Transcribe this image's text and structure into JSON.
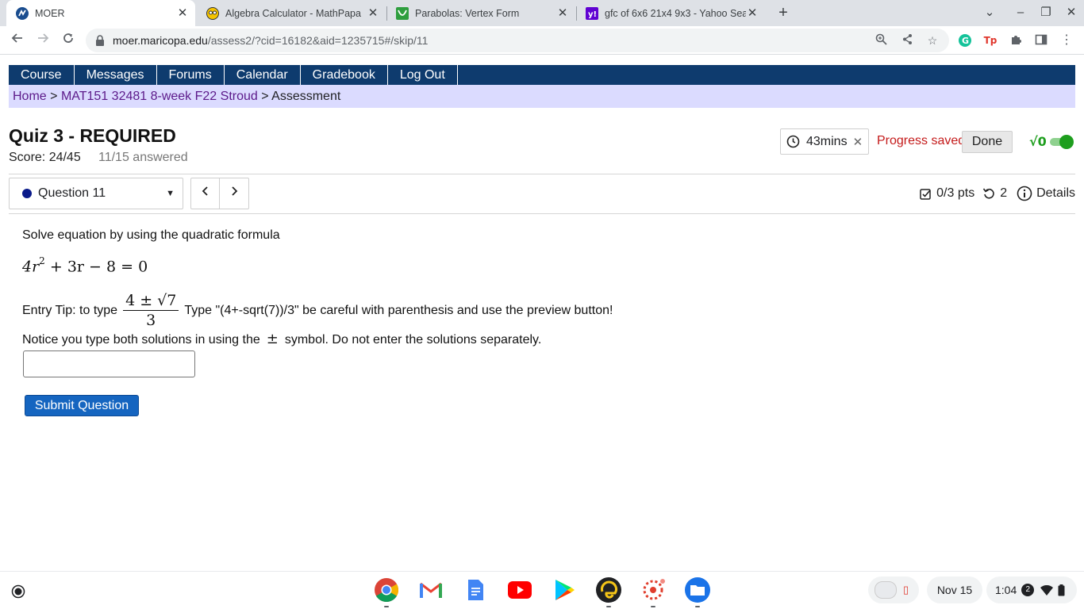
{
  "browser": {
    "tabs": [
      {
        "title": "MOER",
        "active": true
      },
      {
        "title": "Algebra Calculator - MathPapa",
        "active": false
      },
      {
        "title": "Parabolas: Vertex Form",
        "active": false
      },
      {
        "title": "gfc of 6x6 21x4 9x3 - Yahoo Sea",
        "active": false
      }
    ],
    "url_host": "moer.maricopa.edu",
    "url_path": "/assess2/?cid=16182&aid=1235715#/skip/11"
  },
  "site_nav": {
    "items": [
      "Course",
      "Messages",
      "Forums",
      "Calendar",
      "Gradebook",
      "Log Out"
    ]
  },
  "breadcrumb": {
    "home": "Home",
    "sep": ">",
    "course": "MAT151 32481 8-week F22 Stroud",
    "current": "Assessment"
  },
  "quiz": {
    "title": "Quiz 3 - REQUIRED",
    "score": "Score: 24/45",
    "answered": "11/15 answered",
    "timer": "43mins",
    "progress_saved": "Progress saved",
    "done_label": "Done",
    "sqrt_label": "√0"
  },
  "question_bar": {
    "selected": "Question 11",
    "points": "0/3 pts",
    "retries": "2",
    "details": "Details"
  },
  "question": {
    "prompt": "Solve equation by using the quadratic formula",
    "equation": {
      "a": "4r",
      "exp": "2",
      "rest": "+ 3r − 8 = 0"
    },
    "tip_prefix": "Entry Tip: to type",
    "tip_frac_num": "4 ± √7",
    "tip_frac_den": "3",
    "tip_suffix": "Type \"(4+-sqrt(7))/3\" be careful with parenthesis and use the preview button!",
    "notice_prefix": "Notice you type both solutions in using the",
    "notice_symbol": "±",
    "notice_suffix": "symbol. Do not enter the solutions separately.",
    "answer_value": "",
    "submit_label": "Submit Question"
  },
  "shelf": {
    "date": "Nov 15",
    "time": "1:04",
    "notification_count": "2"
  },
  "colors": {
    "nav_bg": "#0e3b6e",
    "breadcrumb_bg": "#dbdbff",
    "link": "#5c1a8a",
    "saved_red": "#c41a1a",
    "submit_blue": "#1565c0",
    "toggle_green": "#1e9e1e"
  }
}
